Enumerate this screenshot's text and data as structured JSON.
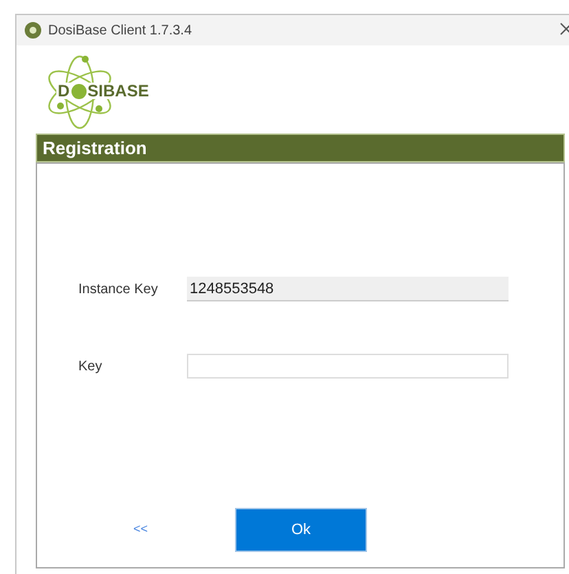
{
  "window": {
    "title": "DosiBase Client 1.7.3.4"
  },
  "logo": {
    "text_start": "D",
    "text_end": "SIBASE"
  },
  "section": {
    "title": "Registration"
  },
  "fields": [
    {
      "label": "Instance Key",
      "value": "1248553548",
      "disabled": true
    },
    {
      "label": "Key",
      "disabled": false
    }
  ],
  "back_link": "<<",
  "ok_button": "Ok"
}
